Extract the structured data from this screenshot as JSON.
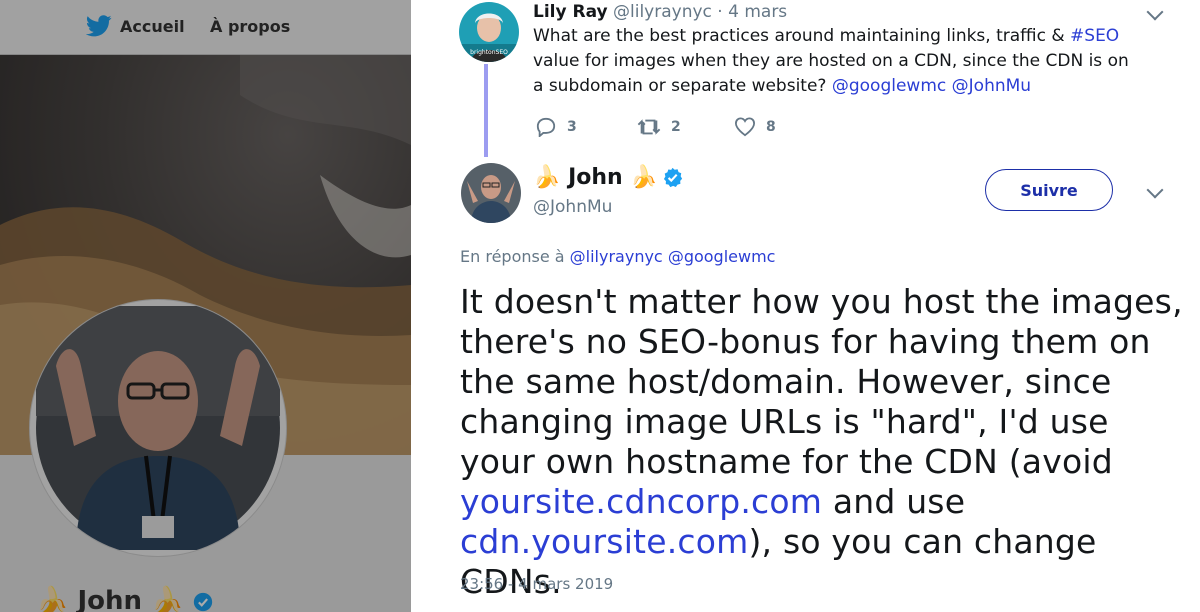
{
  "nav": {
    "home_label": "Accueil",
    "about_label": "À propos"
  },
  "background_profile": {
    "name": "John"
  },
  "reply_tweet": {
    "author_name": "Lily Ray",
    "author_handle": "@lilyraynyc",
    "separator": " · ",
    "date": "4 mars",
    "text_part1": "What are the best practices around maintaining links, traffic & ",
    "hashtag": "#SEO",
    "text_part2": " value for images when they are hosted on a CDN, since the CDN is on a subdomain or separate website? ",
    "mention1": "@googlewmc",
    "mention2": "@JohnMu",
    "avatar_caption": "brightonSEO",
    "replies": "3",
    "retweets": "2",
    "likes": "8"
  },
  "main_tweet": {
    "author_name": "John",
    "author_handle": "@JohnMu",
    "follow_label": "Suivre",
    "in_reply_prefix": "En réponse à ",
    "in_reply_mention1": "@lilyraynyc",
    "in_reply_mention2": "@googlewmc",
    "text_part1": "It doesn't matter how you host the images, there's no SEO-bonus for having them on the same host/domain. However, since changing image URLs is \"hard\", I'd use your own hostname for the CDN (avoid ",
    "link1": "yoursite.cdncorp.com",
    "text_part2": " and use ",
    "link2": "cdn.yoursite.com",
    "text_part3": "), so you can change CDNs.",
    "timestamp": "23:56 - 4 mars 2019"
  },
  "colors": {
    "link": "#2b3ed4",
    "muted": "#657786",
    "follow_border": "#1d2fa8",
    "verified": "#1da1f2",
    "thread_line": "#9c9cf0",
    "twitter_blue": "#1da1f2"
  },
  "icons": [
    "twitter-bird-icon",
    "chevron-down-icon",
    "reply-icon",
    "retweet-icon",
    "like-icon",
    "verified-badge-icon",
    "banana-emoji-icon"
  ]
}
